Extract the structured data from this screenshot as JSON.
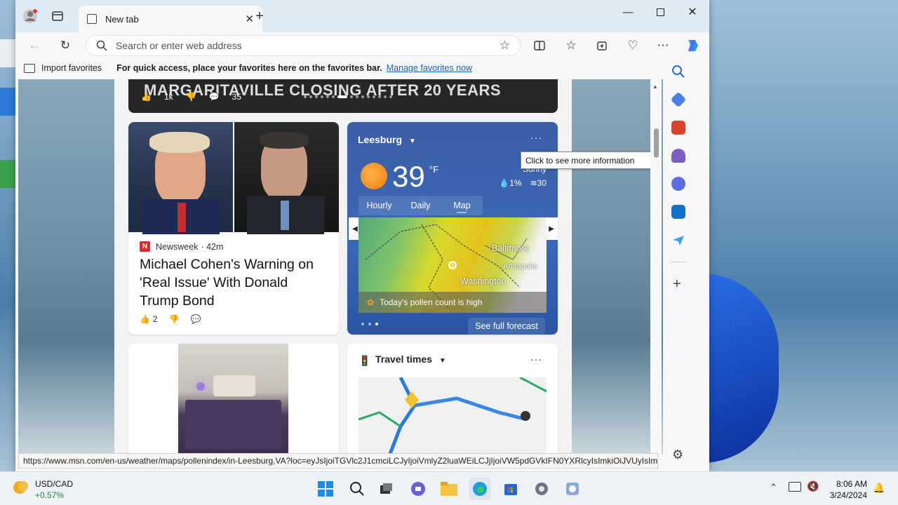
{
  "browser": {
    "tab_title": "New tab",
    "address_placeholder": "Search or enter web address",
    "favorites_bar": {
      "import_label": "Import favorites",
      "message": "For quick access, place your favorites here on the favorites bar.",
      "manage_link": "Manage favorites now"
    },
    "status_url": "https://www.msn.com/en-us/weather/maps/pollenindex/in-Leesburg,VA?loc=eyJsIjoiTGVlc2J1cmciLCJyIjoiVmlyZ2luaWEiLCJjIjoiVW5pdGVkIFN0YXRlcyIsImkiOiJVUyIsImci..."
  },
  "feed": {
    "top_story": {
      "headline": "MARGARITAVILLE CLOSING AFTER 20 YEARS",
      "likes": "1k",
      "comments": "35"
    },
    "news_card": {
      "source": "Newsweek",
      "time": "· 42m",
      "headline": "Michael Cohen's Warning on 'Real Issue' With Donald Trump Bond",
      "likes": "2"
    },
    "weather": {
      "location": "Leesburg",
      "temperature": "39",
      "unit": "°F",
      "condition": "Sunny",
      "precip": "1%",
      "wind": "30",
      "tabs": [
        "Hourly",
        "Daily",
        "Map"
      ],
      "active_tab": "Map",
      "cities": [
        "Baltimore",
        "Annapolis",
        "Washington"
      ],
      "pollen_text": "Today's pollen count is high",
      "forecast_link": "See full forecast"
    },
    "travel": {
      "title": "Travel times"
    }
  },
  "tooltip": "Click to see more information",
  "taskbar": {
    "ticker_symbol": "USD/CAD",
    "ticker_change": "+0.57%",
    "time": "8:06 AM",
    "date": "3/24/2024"
  },
  "colors": {
    "accent": "#1464b8",
    "weather_card": "#3b68b8",
    "ticker_positive": "#1a8f3a"
  }
}
